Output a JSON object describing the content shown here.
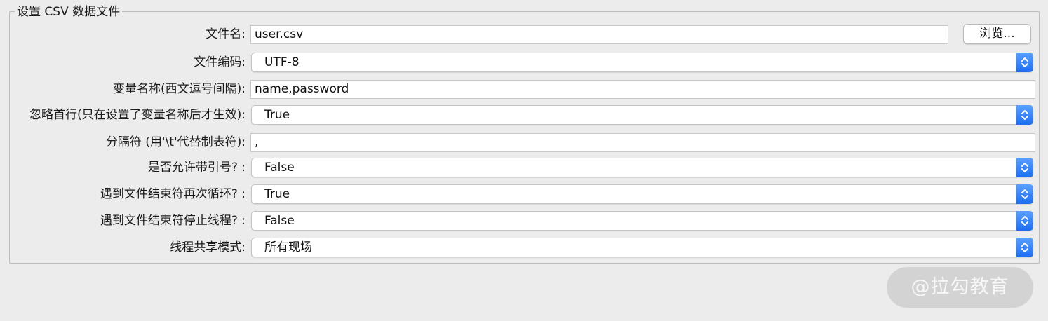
{
  "panel": {
    "title": "设置 CSV 数据文件"
  },
  "fields": {
    "filename": {
      "label": "文件名:",
      "value": "user.csv",
      "browse_label": "浏览..."
    },
    "encoding": {
      "label": "文件编码:",
      "value": "UTF-8"
    },
    "variable_names": {
      "label": "变量名称(西文逗号间隔):",
      "value": "name,password"
    },
    "ignore_first_line": {
      "label": "忽略首行(只在设置了变量名称后才生效):",
      "value": "True"
    },
    "delimiter": {
      "label": "分隔符 (用'\\t'代替制表符):",
      "value": ","
    },
    "allow_quoted": {
      "label": "是否允许带引号? :",
      "value": "False"
    },
    "recycle_on_eof": {
      "label": "遇到文件结束符再次循环? :",
      "value": "True"
    },
    "stop_thread_on_eof": {
      "label": "遇到文件结束符停止线程? :",
      "value": "False"
    },
    "sharing_mode": {
      "label": "线程共享模式:",
      "value": "所有现场"
    }
  },
  "icons": {
    "select_arrow": "up-down-chevron-icon"
  },
  "colors": {
    "accent": "#2f7ff5",
    "background": "#ececec"
  },
  "watermark": {
    "text": "@拉勾教育"
  }
}
